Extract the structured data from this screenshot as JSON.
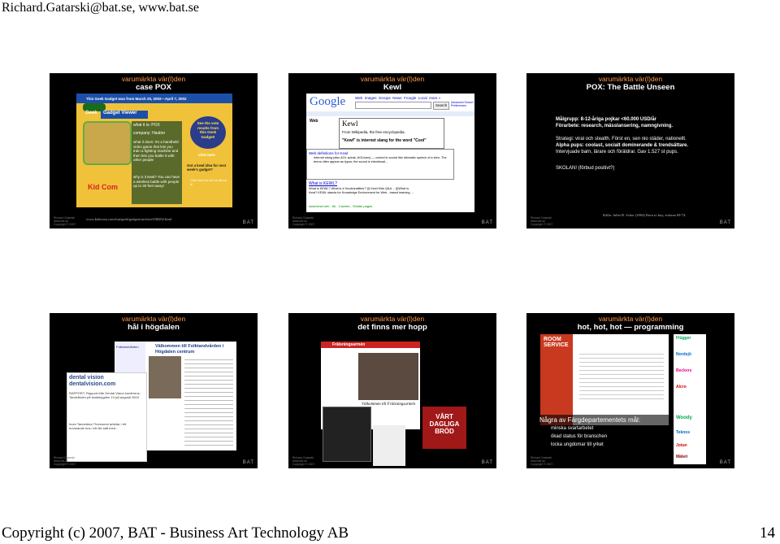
{
  "header": {
    "text": "Richard.Gatarski@bat.se, www.bat.se"
  },
  "footer": {
    "copyright": "Copyright (c) 2007, BAT - Business Art Technology AB",
    "page": "14"
  },
  "common": {
    "supertitle": "varumärkta vär(l)den",
    "copyright_lines": [
      "Richard Gatarski",
      "www.bat.se",
      "Copyright © 2007"
    ],
    "logo": "BAT"
  },
  "slides": {
    "s1": {
      "title": "case POX",
      "url": "www.kidscom.com/fun/geek/gadgets/archive/040202.html",
      "banner": "This Geek Gadget was from March 20, 2002—April 7, 2002",
      "viewer": "Gadget Viewer",
      "what_is": "what it is: POX",
      "company": "company: Hasbro",
      "what_does": "what it does: It's a handheld video game that lets you train a fighting machine and then lets you battle it with other people",
      "why": "why is it kewl? You can have a wireless battle with people up to 30 feet away!",
      "see": "See the vote results from this Geek Gadget!",
      "click": "click here",
      "got": "Got a kewl idea for next week's gadget?",
      "click2": "Click here to tell us about it!",
      "kid": "Kid Com",
      "gear": "Geek"
    },
    "s2": {
      "title": "Kewl",
      "google": "Google",
      "tabs": [
        "Web",
        "Images",
        "Groups",
        "News",
        "Froogle",
        "Local",
        "more »"
      ],
      "search": "Search",
      "adv": "Advanced Search Preferences",
      "web": "Web",
      "popup_title": "Kewl",
      "popup_sub": "From Wikipedia, the free encyclopedia.",
      "popup_def": "\"Kewl\" is internet slang for the word \"Cool\"",
      "defs_head": "Web definitions for Kewl",
      "defs_text": "Internet slang (also AOL speak, AOLisms) — coined to sound like idiomatic speech of a teen. The terms often appear as typos; the sound is intentional...",
      "what_is": "What is KEWL?",
      "what_is2": "What is KEWL? What is a 'functionalities'? [I] Kewl Kids Q&A ... [I]What is Kewl? KEWL stands for Knowledge Environment for Web - based learning ...",
      "url1": "www.kewl.net/ - 6k - Cached - Similar pages"
    },
    "s3": {
      "title": "POX: The Battle Unseen",
      "l1": "Målgrupp: 8-12-åriga pojkar <60.000 USD/år",
      "l2": "Förarbete: research, mässlansering, namngivning.",
      "l3": "Strategi: viral och stealth. Först en, sen nio städer, nationellt.",
      "l4": "Alpha pups: coolast, socialt dominerande & trendsättare.",
      "l5": "Intervjuade barn, lärare och föräldrar. Gav 1.527 st pups.",
      "l6": "SKOLAN! (förbud positivt?)",
      "source": "Källa: Juliet B. Schor (2004) Born to buy, sidorna 69-74."
    },
    "s4": {
      "title": "hål i högdalen",
      "site_head": "Välkommen till Folktandvården i Högdalen centrum",
      "dental": "dental vision dentalvision.com",
      "rapport": "RAPPORT, Rapport från Dental Vision konferens: Tandvården på landsbygden 19 juli augusti 2004",
      "quote": "Inom Tandvärna Thornsund arbetar i ett nuvarande hus i ett rikt sätt med...",
      "folk": "Folktandvården"
    },
    "s5": {
      "title": "det finns mer hopp",
      "front": "Frälsningsarmén",
      "welcome": "Välkommen till Frälsningsarmén",
      "banner": "VÅRT DAGLIGA BRÖD"
    },
    "s6": {
      "title": "hot, hot, hot — programming",
      "room": "ROOM SERVICE",
      "msg_head": "Några av Färgdepartementets mål:",
      "msg1": "minska svartarbetet",
      "msg2": "ökad status för branschen",
      "msg3": "locka ungdomar till yrket",
      "sponsors": [
        "Flügger",
        "Nordsjö",
        "Beckers",
        "Alcro",
        "Woody",
        "Teknos",
        "Jotun",
        "Mäleri"
      ]
    }
  },
  "colors": {
    "accent": "#ff9a4d",
    "slide_bg": "#000000",
    "kidsbg": "#2a3c8a",
    "geek": "#6a7c20"
  }
}
